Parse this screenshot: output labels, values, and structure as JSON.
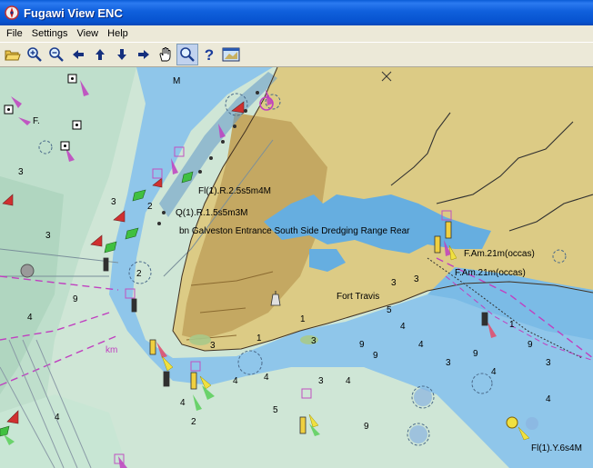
{
  "window": {
    "title": "Fugawi View ENC"
  },
  "menu": {
    "file": "File",
    "settings": "Settings",
    "view": "View",
    "help": "Help"
  },
  "toolbar": {
    "icons": [
      "open-folder-icon",
      "zoom-in-icon",
      "zoom-out-icon",
      "arrow-left-icon",
      "arrow-up-icon",
      "arrow-down-icon",
      "arrow-right-icon",
      "pan-hand-icon",
      "zoom-box-icon",
      "help-icon",
      "chart-window-icon"
    ],
    "active": "zoom-box-icon"
  },
  "map": {
    "colors": {
      "deep_water": "#d4ecdf",
      "mid_water": "#b8dcc8",
      "shallow_water": "#8fc6ea",
      "land": "#dcca83",
      "urban": "#c4a862",
      "channel_blue": "#66aee0",
      "magenta": "#c040c0"
    },
    "labels": {
      "light1": "Fl(1).R.2.5s5m4M",
      "light2": "Q(1).R.1.5s5m3M",
      "range_rear": "bn Galveston Entrance South Side Dredging Range Rear",
      "famp1": "F.Am.21m(occas)",
      "famp2": "F.Am.21m(occas)",
      "fort": "Fort Travis",
      "light_yellow": "Fl(1).Y.6s4M",
      "m_letter": "M",
      "f_letter": "F.",
      "km": "km",
      "buoy_2": "2"
    },
    "soundings": [
      "3",
      "2",
      "1",
      "3",
      "4",
      "5",
      "9",
      "2",
      "4",
      "3",
      "1",
      "3",
      "4",
      "3",
      "3",
      "4",
      "9",
      "4",
      "3",
      "9",
      "1",
      "4",
      "9",
      "3",
      "4",
      "5",
      "9",
      "4",
      "3",
      "4",
      "9",
      "3",
      "4"
    ]
  }
}
